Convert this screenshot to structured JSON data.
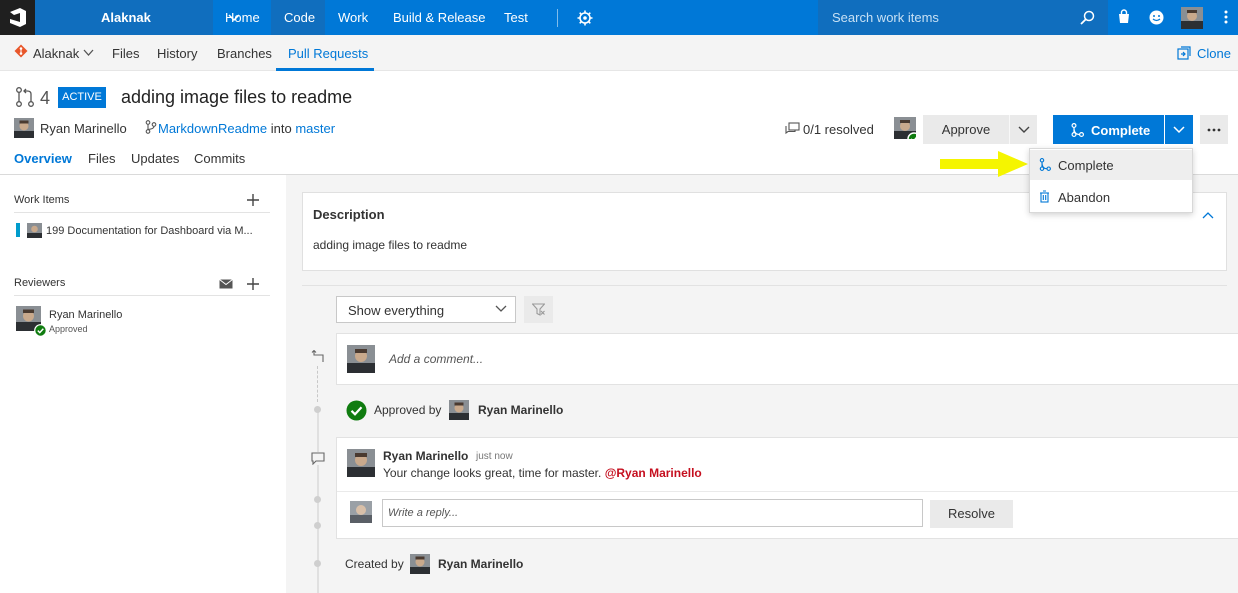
{
  "topbar": {
    "project": "Alaknak",
    "hubs": [
      "Home",
      "Code",
      "Work",
      "Build & Release",
      "Test"
    ],
    "active_hub": "Code",
    "search_placeholder": "Search work items",
    "colors": {
      "bar": "#0078d7",
      "logo_bg": "#1f1f1f"
    }
  },
  "subnav": {
    "repo": "Alaknak",
    "items": [
      "Files",
      "History",
      "Branches",
      "Pull Requests"
    ],
    "active": "Pull Requests",
    "clone_label": "Clone"
  },
  "pr": {
    "id": "4",
    "status": "ACTIVE",
    "title": "adding image files to readme",
    "author": "Ryan Marinello",
    "source_branch": "MarkdownReadme",
    "into_word": "into",
    "target_branch": "master",
    "resolved": "0/1 resolved",
    "approve_label": "Approve",
    "complete_label": "Complete",
    "more_label": "..."
  },
  "tabs": [
    "Overview",
    "Files",
    "Updates",
    "Commits"
  ],
  "menu": {
    "items": [
      {
        "label": "Complete",
        "icon": "merge-icon"
      },
      {
        "label": "Abandon",
        "icon": "trash-icon"
      }
    ]
  },
  "left": {
    "work_items_header": "Work Items",
    "work_item_text": "199 Documentation for Dashboard via M...",
    "reviewers_header": "Reviewers",
    "reviewer_name": "Ryan Marinello",
    "reviewer_status": "Approved"
  },
  "description": {
    "title": "Description",
    "text": "adding image files to readme"
  },
  "activity": {
    "filter": "Show everything",
    "comment_placeholder": "Add a comment...",
    "approved_by": "Approved by",
    "approved_name": "Ryan Marinello",
    "thread": {
      "author": "Ryan Marinello",
      "time": "just now",
      "text": "Your change looks great, time for master.",
      "mention": "@Ryan Marinello"
    },
    "reply_placeholder": "Write a reply...",
    "resolve_label": "Resolve",
    "created_by": "Created by",
    "created_name": "Ryan Marinello"
  }
}
